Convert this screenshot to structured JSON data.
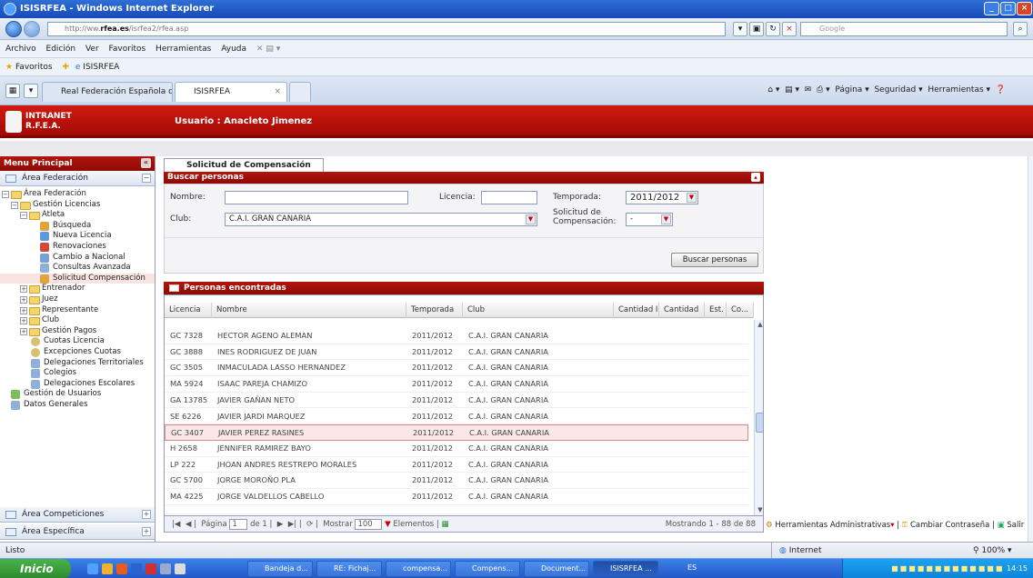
{
  "window": {
    "title": "ISISRFEA - Windows Internet Explorer"
  },
  "address": {
    "url_prefix": "http://ww.",
    "url_host": "rfea.es",
    "url_path": "/isrfea2/rfea.asp",
    "search_placeholder": "Google"
  },
  "menu": [
    "Archivo",
    "Edición",
    "Ver",
    "Favoritos",
    "Herramientas",
    "Ayuda"
  ],
  "favorites": {
    "label": "Favoritos",
    "item": "ISISRFEA"
  },
  "browser_tabs": [
    {
      "label": "Real Federación Española de..."
    },
    {
      "label": "ISISRFEA"
    }
  ],
  "command_bar": {
    "pagina": "Página",
    "seguridad": "Seguridad",
    "herramientas": "Herramientas"
  },
  "app": {
    "logo_line1": "INTRANET",
    "logo_line2": "R.F.E.A.",
    "user": "Usuario : Anacleto Jimenez"
  },
  "sidebar": {
    "header": "Menu Principal",
    "sections": {
      "federacion": "Área Federación",
      "competiciones": "Área Competiciones",
      "especifica": "Área Específica"
    },
    "tree": [
      {
        "label": "Área Federación"
      },
      {
        "label": "Gestión Licencias"
      },
      {
        "label": "Atleta"
      },
      {
        "label": "Búsqueda"
      },
      {
        "label": "Nueva Licencia"
      },
      {
        "label": "Renovaciones"
      },
      {
        "label": "Cambio a Nacional"
      },
      {
        "label": "Consultas Avanzada"
      },
      {
        "label": "Solicitud Compensación"
      },
      {
        "label": "Entrenador"
      },
      {
        "label": "Juez"
      },
      {
        "label": "Representante"
      },
      {
        "label": "Club"
      },
      {
        "label": "Gestión Pagos"
      },
      {
        "label": "Cuotas Licencia"
      },
      {
        "label": "Excepciones Cuotas"
      },
      {
        "label": "Delegaciones Territoriales"
      },
      {
        "label": "Colegios"
      },
      {
        "label": "Delegaciones Escolares"
      },
      {
        "label": "Gestión de Usuarios"
      },
      {
        "label": "Datos Generales"
      }
    ]
  },
  "main": {
    "tab": "Solicitud de Compensación",
    "search": {
      "header": "Buscar personas",
      "nombre_label": "Nombre:",
      "nombre_value": "",
      "licencia_label": "Licencia:",
      "licencia_value": "",
      "temporada_label": "Temporada:",
      "temporada_value": "2011/2012",
      "club_label": "Club:",
      "club_value": "C.A.I. GRAN CANARIA",
      "solicitud_label1": "Solicitud de",
      "solicitud_label2": "Compensación:",
      "solicitud_value": "-",
      "button": "Buscar personas"
    },
    "results": {
      "header": "Personas encontradas",
      "columns": [
        "Licencia",
        "Nombre",
        "Temporada",
        "Club",
        "Cantidad I...",
        "Cantidad",
        "Est.",
        "Co..."
      ],
      "rows": [
        [
          "GC 7328",
          "HECTOR AGENO ALEMAN",
          "2011/2012",
          "C.A.I. GRAN CANARIA"
        ],
        [
          "GC 3888",
          "INES RODRIGUEZ DE JUAN",
          "2011/2012",
          "C.A.I. GRAN CANARIA"
        ],
        [
          "GC 3505",
          "INMACULADA LASSO HERNANDEZ",
          "2011/2012",
          "C.A.I. GRAN CANARIA"
        ],
        [
          "MA 5924",
          "ISAAC PAREJA CHAMIZO",
          "2011/2012",
          "C.A.I. GRAN CANARIA"
        ],
        [
          "GA 13785",
          "JAVIER GAÑAN NETO",
          "2011/2012",
          "C.A.I. GRAN CANARIA"
        ],
        [
          "SE 6226",
          "JAVIER JARDI MARQUEZ",
          "2011/2012",
          "C.A.I. GRAN CANARIA"
        ],
        [
          "GC 3407",
          "JAVIER PEREZ RASINES",
          "2011/2012",
          "C.A.I. GRAN CANARIA"
        ],
        [
          "H 2658",
          "JENNIFER RAMIREZ BAYO",
          "2011/2012",
          "C.A.I. GRAN CANARIA"
        ],
        [
          "LP 222",
          "JHOAN ANDRES RESTREPO MORALES",
          "2011/2012",
          "C.A.I. GRAN CANARIA"
        ],
        [
          "GC 5700",
          "JORGE MOROÑO PLA",
          "2011/2012",
          "C.A.I. GRAN CANARIA"
        ],
        [
          "MA 4225",
          "JORGE VALDELLOS CABELLO",
          "2011/2012",
          "C.A.I. GRAN CANARIA"
        ]
      ],
      "highlighted_row": 6
    },
    "pager": {
      "pagina": "Página",
      "page": "1",
      "of": "de 1",
      "mostrar": "Mostrar",
      "size": "100",
      "elementos": "Elementos",
      "showing": "Mostrando 1 - 88 de 88"
    }
  },
  "tools": {
    "admin": "Herramientas Administrativas",
    "password": "Cambiar Contraseña",
    "exit": "Salir"
  },
  "status": {
    "left": "Listo",
    "zone": "Internet",
    "zoom": "100%"
  },
  "taskbar": {
    "start": "Inicio",
    "buttons": [
      "Bandeja d...",
      "RE: Fichaj...",
      "compensa...",
      "Compens...",
      "Document...",
      "ISISRFEA ..."
    ],
    "lang": "ES",
    "clock": "14:15"
  },
  "colors": {
    "app_red": "#c0140c",
    "xp_blue": "#2458c8",
    "highlight": "#fbe8e6"
  }
}
